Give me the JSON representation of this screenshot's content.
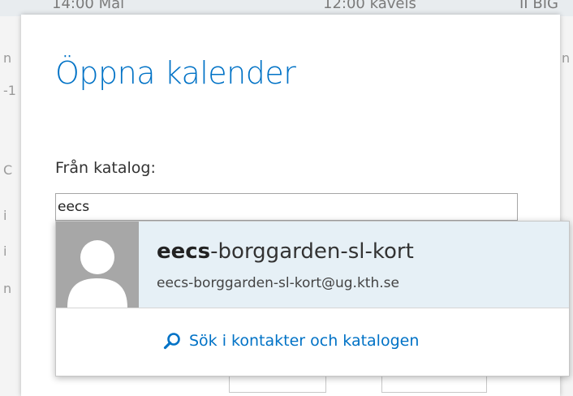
{
  "dialog": {
    "title": "Öppna kalender",
    "directory_label": "Från katalog:",
    "search_value": "eecs"
  },
  "suggestion": {
    "name_match": "eecs",
    "name_rest": "-borggarden-sl-kort",
    "email": "eecs-borggarden-sl-kort@ug.kth.se"
  },
  "search_link": {
    "label": "Sök i kontakter och katalogen"
  },
  "background": {
    "top_left": "14:00 Mai",
    "top_middle": "12:00 kåveis",
    "top_right": "II BIG"
  },
  "colors": {
    "accent": "#0072c6",
    "highlight": "#e6f0f6",
    "avatar_bg": "#a7a7a7"
  }
}
